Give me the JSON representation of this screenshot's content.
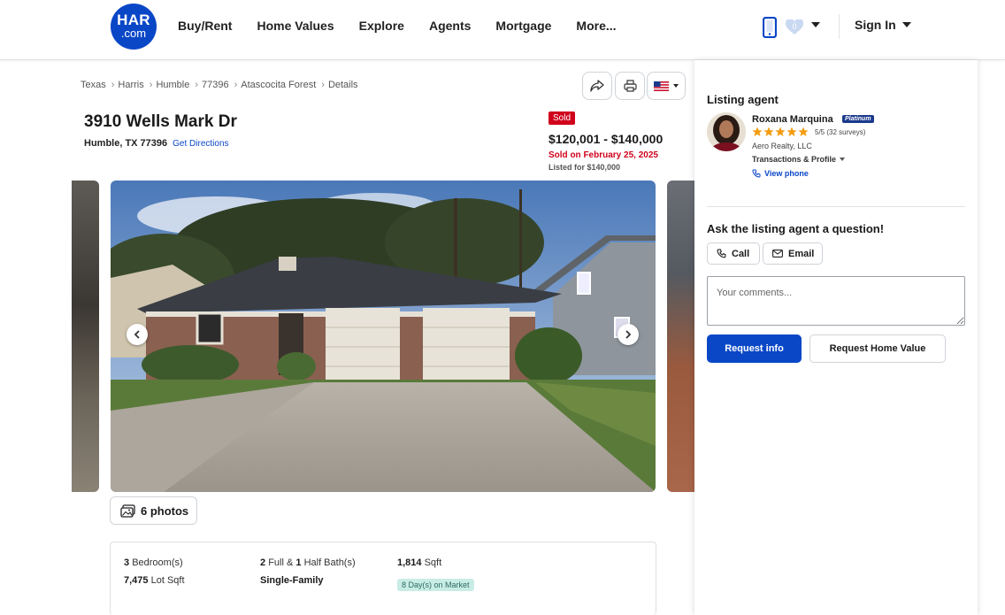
{
  "header": {
    "logo": {
      "line1": "HAR",
      "line2": ".com"
    },
    "nav": [
      "Buy/Rent",
      "Home Values",
      "Explore",
      "Agents",
      "Mortgage",
      "More..."
    ],
    "favorites_count": "0",
    "sign_in": "Sign In"
  },
  "breadcrumb": [
    "Texas",
    "Harris",
    "Humble",
    "77396",
    "Atascocita Forest",
    "Details"
  ],
  "listing": {
    "address": "3910 Wells Mark Dr",
    "city_line": "Humble, TX 77396",
    "directions_link": "Get Directions",
    "status_badge": "Sold",
    "price_range": "$120,001 - $140,000",
    "sold_date": "Sold on February 25, 2025",
    "listed_for": "Listed for $140,000",
    "photos_button": "6 photos",
    "facts": {
      "bedrooms_value": "3",
      "bedrooms_label": "Bedroom(s)",
      "lot_value": "7,475",
      "lot_label": "Lot Sqft",
      "full_bath_value": "2",
      "full_label": "Full &",
      "half_bath_value": "1",
      "half_label": "Half Bath(s)",
      "type": "Single-Family",
      "sqft_value": "1,814",
      "sqft_label": "Sqft",
      "days_on_market": "8 Day(s) on Market"
    }
  },
  "agent": {
    "heading": "Listing agent",
    "name": "Roxana Marquina",
    "tier": "Platinum",
    "rating": 5,
    "rating_text": "5/5 (32 surveys)",
    "company": "Aero Realty, LLC",
    "transactions_link": "Transactions & Profile",
    "view_phone": "View phone"
  },
  "contact": {
    "heading": "Ask the listing agent a question!",
    "call": "Call",
    "email": "Email",
    "comments_placeholder": "Your comments...",
    "request_info": "Request info",
    "request_home_value": "Request Home Value"
  },
  "colors": {
    "brand_blue": "#0a47c7",
    "sold_red": "#d0021b",
    "star_orange": "#f39c12",
    "dom_badge_bg": "#c9ece5"
  }
}
